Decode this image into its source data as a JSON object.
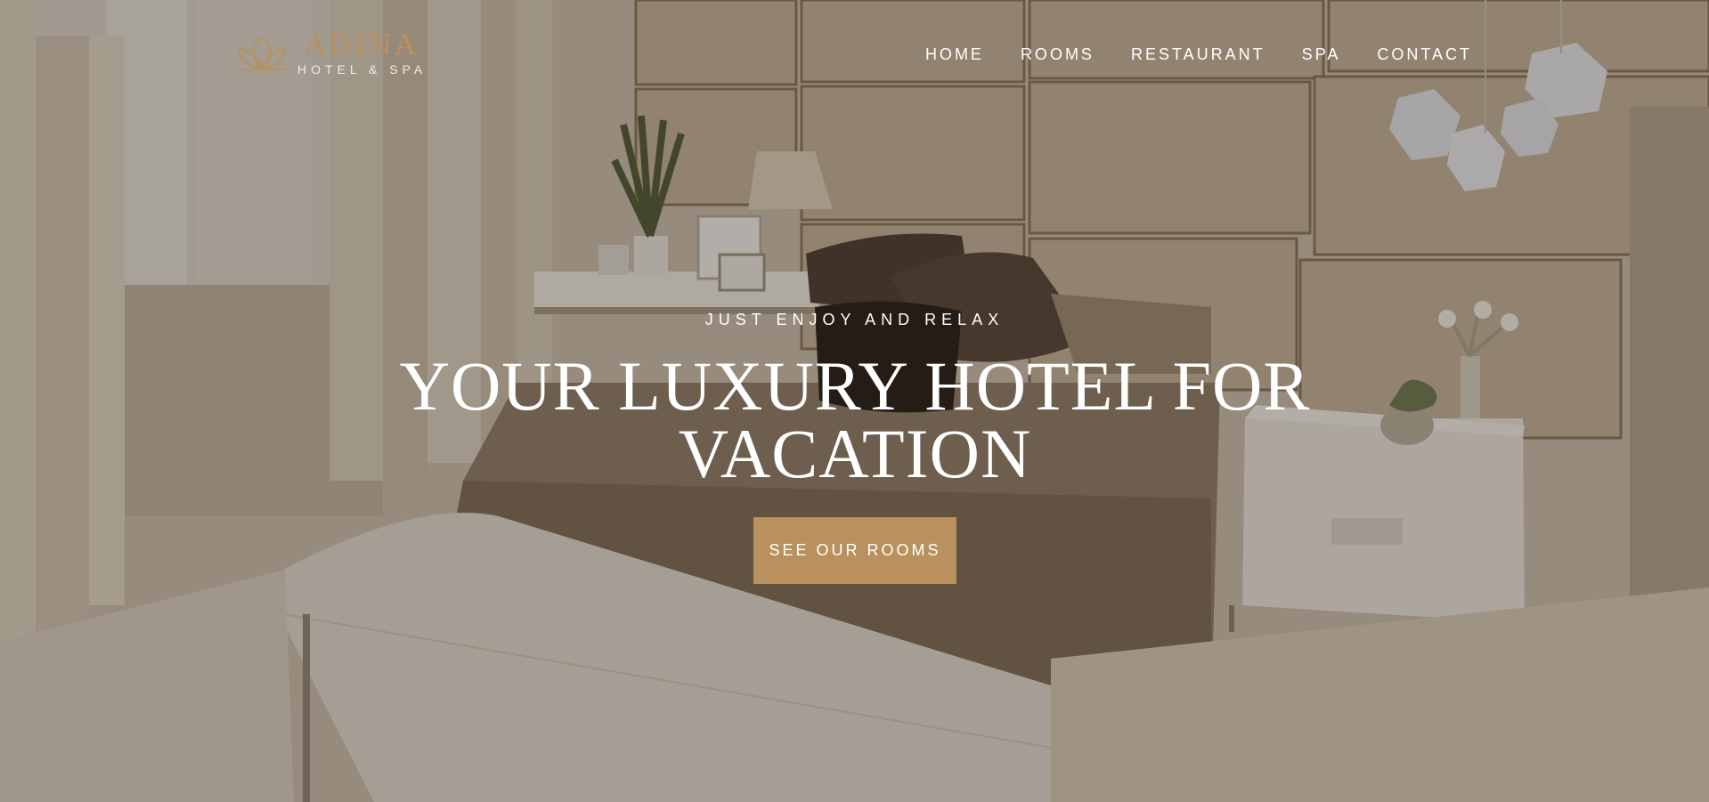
{
  "brand": {
    "name": "ADINA",
    "subtitle": "HOTEL & SPA",
    "accent_color": "#b8915e",
    "logo_icon": "lotus-icon"
  },
  "nav": {
    "items": [
      {
        "label": "HOME"
      },
      {
        "label": "ROOMS"
      },
      {
        "label": "RESTAURANT"
      },
      {
        "label": "SPA"
      },
      {
        "label": "CONTACT"
      }
    ]
  },
  "hero": {
    "eyebrow": "JUST ENJOY AND RELAX",
    "headline": "YOUR LUXURY HOTEL FOR VACATION",
    "cta_label": "SEE OUR ROOMS",
    "background": "hotel-bedroom-photo"
  }
}
